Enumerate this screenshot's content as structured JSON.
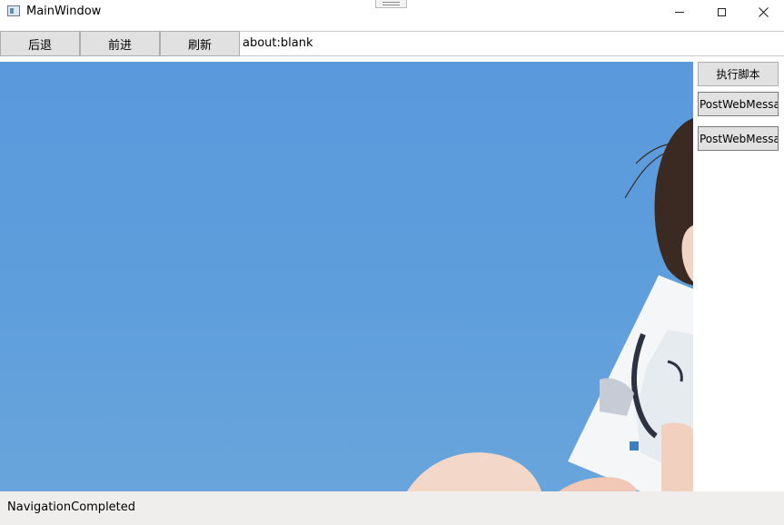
{
  "window": {
    "title": "MainWindow",
    "controls": [
      "minimize-icon",
      "maximize-icon",
      "close-icon"
    ]
  },
  "toolbar": {
    "back_label": "后退",
    "forward_label": "前进",
    "refresh_label": "刷新",
    "address_value": "about:blank"
  },
  "side_panel": {
    "execute_script_label": "执行脚本",
    "post_message_1_label": "PostWebMessa",
    "post_message_2_label": "PostWebMessa"
  },
  "status": {
    "text": "NavigationCompleted"
  },
  "colors": {
    "sky": "#5e9edc",
    "button_face": "#e1e1e1",
    "status_bar": "#f0eeec"
  }
}
